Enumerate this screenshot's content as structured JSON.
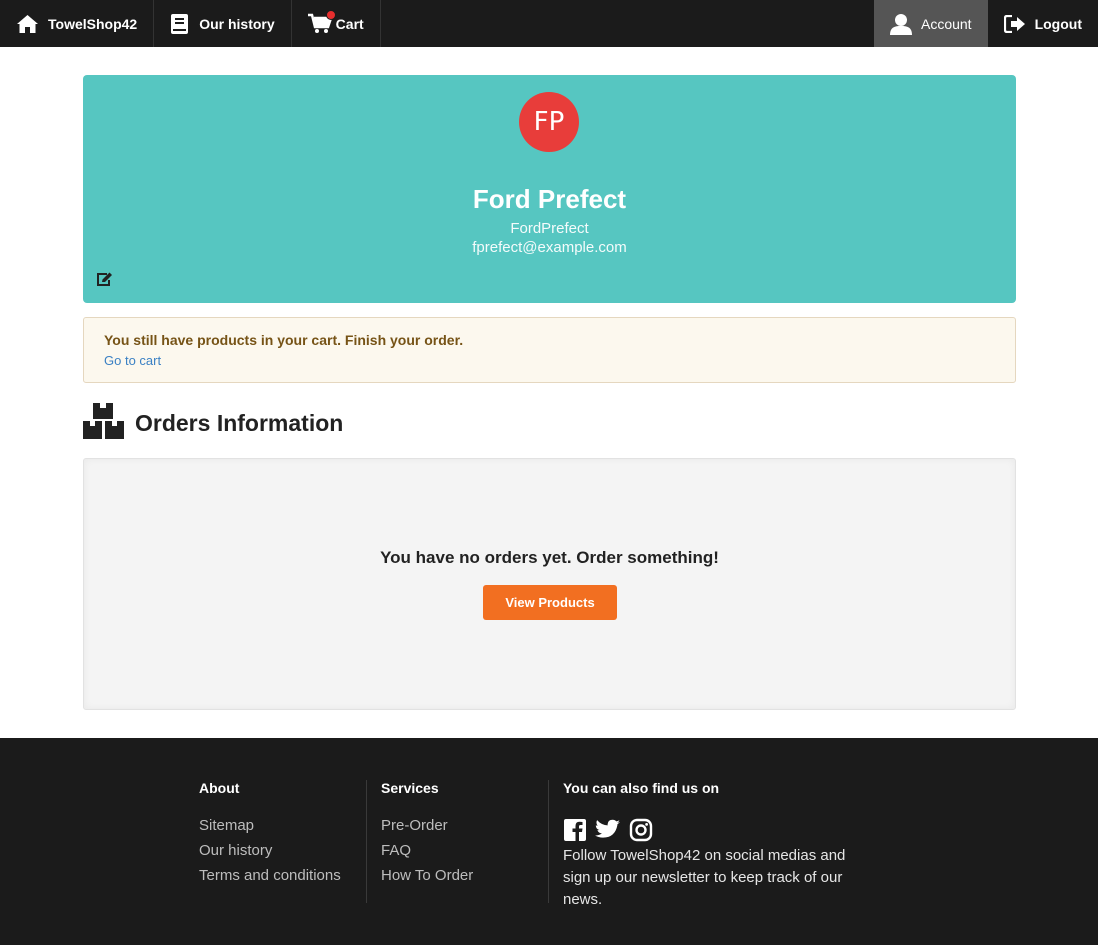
{
  "nav": {
    "brand": "TowelShop42",
    "history": "Our history",
    "cart": "Cart",
    "account": "Account",
    "logout": "Logout"
  },
  "profile": {
    "initials": "FP",
    "full_name": "Ford Prefect",
    "username": "FordPrefect",
    "email": "fprefect@example.com",
    "avatar_color": "#e83d3a",
    "card_color": "#56c6c1"
  },
  "cart_warning": {
    "message": "You still have products in your cart. Finish your order.",
    "link": "Go to cart"
  },
  "orders": {
    "title": "Orders Information",
    "empty_message": "You have no orders yet. Order something!",
    "button": "View Products",
    "button_color": "#f26f21"
  },
  "footer": {
    "about": {
      "heading": "About",
      "links": [
        "Sitemap",
        "Our history",
        "Terms and conditions"
      ]
    },
    "services": {
      "heading": "Services",
      "links": [
        "Pre-Order",
        "FAQ",
        "How To Order"
      ]
    },
    "social": {
      "heading": "You can also find us on",
      "icons": [
        "facebook-icon",
        "twitter-icon",
        "instagram-icon"
      ],
      "text": "Follow TowelShop42 on social medias and sign up our newsletter to keep track of our news."
    }
  }
}
